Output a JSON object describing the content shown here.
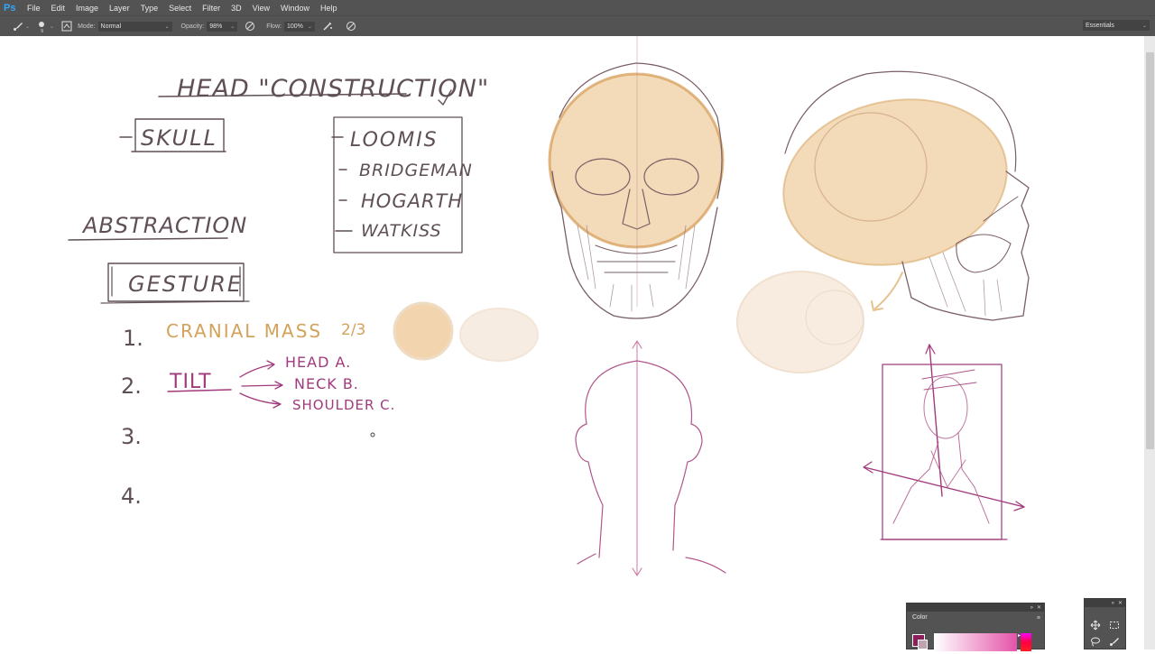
{
  "app": {
    "logo": "Ps"
  },
  "menu": [
    "File",
    "Edit",
    "Image",
    "Layer",
    "Type",
    "Select",
    "Filter",
    "3D",
    "View",
    "Window",
    "Help"
  ],
  "options": {
    "brush_size": "9",
    "mode_label": "Mode:",
    "mode_value": "Normal",
    "opacity_label": "Opacity:",
    "opacity_value": "98%",
    "flow_label": "Flow:",
    "flow_value": "100%",
    "workspace": "Essentials"
  },
  "canvas": {
    "title": "HEAD \"CONSTRUCTION\"",
    "left_notes": [
      "SKULL",
      "ABSTRACTION",
      "GESTURE"
    ],
    "box_list": [
      "LOOMIS",
      "BRIDGEMAN",
      "HOGARTH",
      "WATKISS"
    ],
    "steps": [
      {
        "num": "1.",
        "text": "CRANIAL MASS",
        "extra": "2/3"
      },
      {
        "num": "2.",
        "text": "TILT"
      },
      {
        "num": "3.",
        "text": ""
      },
      {
        "num": "4.",
        "text": ""
      }
    ],
    "tilt_items": [
      "HEAD A.",
      "NECK B.",
      "SHOULDER C."
    ]
  },
  "colors": {
    "ink": "#5f4f57",
    "orange": "#d3a25b",
    "magenta": "#a13a7c",
    "skull_fill": "#f1d3ab"
  },
  "color_panel": {
    "title": "Color",
    "foreground": "#8a1f5a",
    "background": "#c0a2b0"
  },
  "tools_panel": {
    "icons": [
      "move-icon",
      "marquee-icon",
      "lasso-icon",
      "brush-icon"
    ]
  }
}
